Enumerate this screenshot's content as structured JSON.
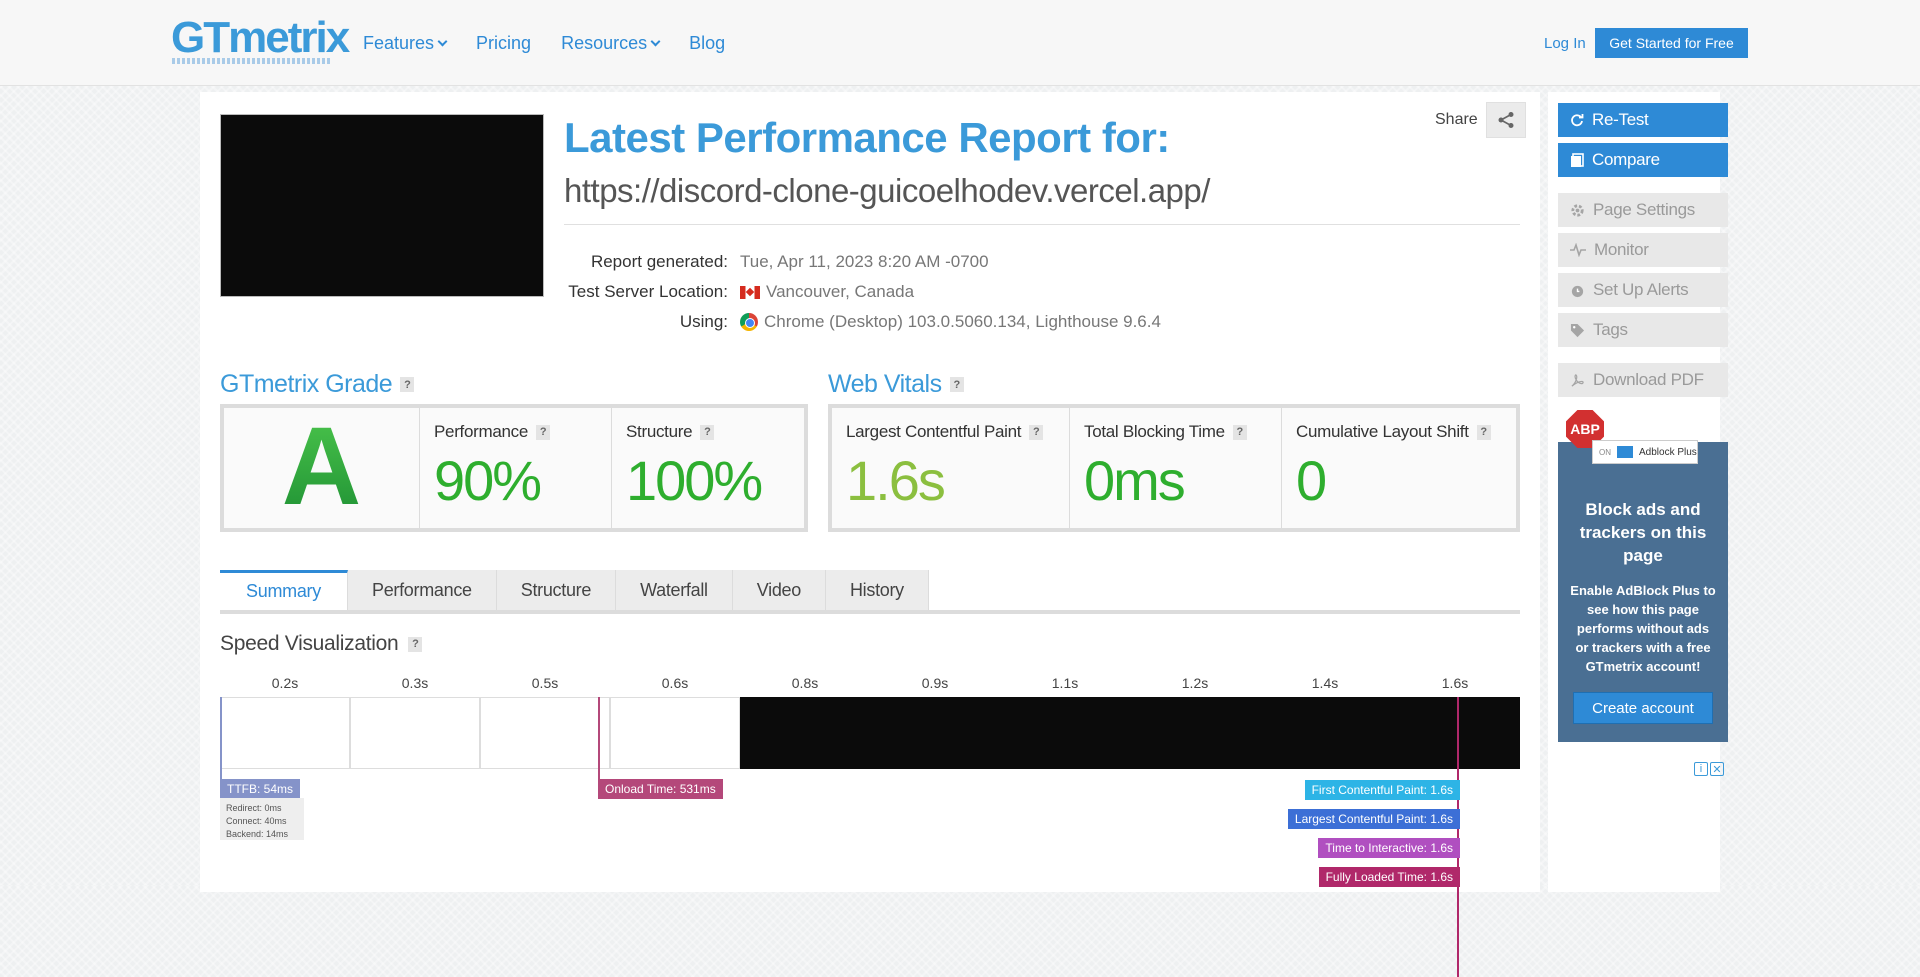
{
  "header": {
    "logo": "GTmetrix",
    "nav": [
      {
        "label": "Features",
        "dropdown": true
      },
      {
        "label": "Pricing",
        "dropdown": false
      },
      {
        "label": "Resources",
        "dropdown": true
      },
      {
        "label": "Blog",
        "dropdown": false
      }
    ],
    "login": "Log In",
    "get_started": "Get Started for Free"
  },
  "report": {
    "title": "Latest Performance Report for:",
    "url": "https://discord-clone-guicoelhodev.vercel.app/",
    "share_label": "Share",
    "meta": {
      "generated_label": "Report generated:",
      "generated_value": "Tue, Apr 11, 2023 8:20 AM -0700",
      "location_label": "Test Server Location:",
      "location_value": "Vancouver, Canada",
      "using_label": "Using:",
      "using_value": "Chrome (Desktop) 103.0.5060.134, Lighthouse 9.6.4"
    }
  },
  "grade": {
    "title": "GTmetrix Grade",
    "letter": "A",
    "performance_label": "Performance",
    "performance_value": "90%",
    "structure_label": "Structure",
    "structure_value": "100%"
  },
  "vitals": {
    "title": "Web Vitals",
    "lcp_label": "Largest Contentful Paint",
    "lcp_value": "1.6s",
    "tbt_label": "Total Blocking Time",
    "tbt_value": "0ms",
    "cls_label": "Cumulative Layout Shift",
    "cls_value": "0"
  },
  "tabs": [
    "Summary",
    "Performance",
    "Structure",
    "Waterfall",
    "Video",
    "History"
  ],
  "active_tab": "Summary",
  "speed": {
    "title": "Speed Visualization",
    "frame_times": [
      "0.2s",
      "0.3s",
      "0.5s",
      "0.6s",
      "0.8s",
      "0.9s",
      "1.1s",
      "1.2s",
      "1.4s",
      "1.6s"
    ],
    "frame_states": [
      "white",
      "white",
      "white",
      "white",
      "black",
      "black",
      "black",
      "black",
      "black",
      "black"
    ],
    "ttfb": "TTFB: 54ms",
    "ttfb_detail": [
      "Redirect: 0ms",
      "Connect: 40ms",
      "Backend: 14ms"
    ],
    "onload": "Onload Time: 531ms",
    "fcp": "First Contentful Paint: 1.6s",
    "lcp": "Largest Contentful Paint: 1.6s",
    "tti": "Time to Interactive: 1.6s",
    "fully_loaded": "Fully Loaded Time: 1.6s"
  },
  "sidebar": {
    "retest": "Re-Test",
    "compare": "Compare",
    "page_settings": "Page Settings",
    "monitor": "Monitor",
    "alerts": "Set Up Alerts",
    "tags": "Tags",
    "download_pdf": "Download PDF"
  },
  "ad": {
    "abp_logo": "ABP",
    "toggle_on": "ON",
    "toggle_label": "Adblock Plus",
    "headline": "Block ads and trackers on this page",
    "body": "Enable AdBlock Plus to see how this page performs without ads or trackers with a free GTmetrix account!",
    "button": "Create account"
  },
  "colors": {
    "brand_blue": "#2e8ad6",
    "grade_green": "#2eae2e",
    "lcp_green": "#8bbf3f",
    "ttfb": "#8593c9",
    "onload": "#b4487a",
    "fcp": "#2db4e6",
    "lcp_tag": "#3c6fd6",
    "tti": "#b04fc0",
    "fully_loaded": "#b0286a"
  }
}
